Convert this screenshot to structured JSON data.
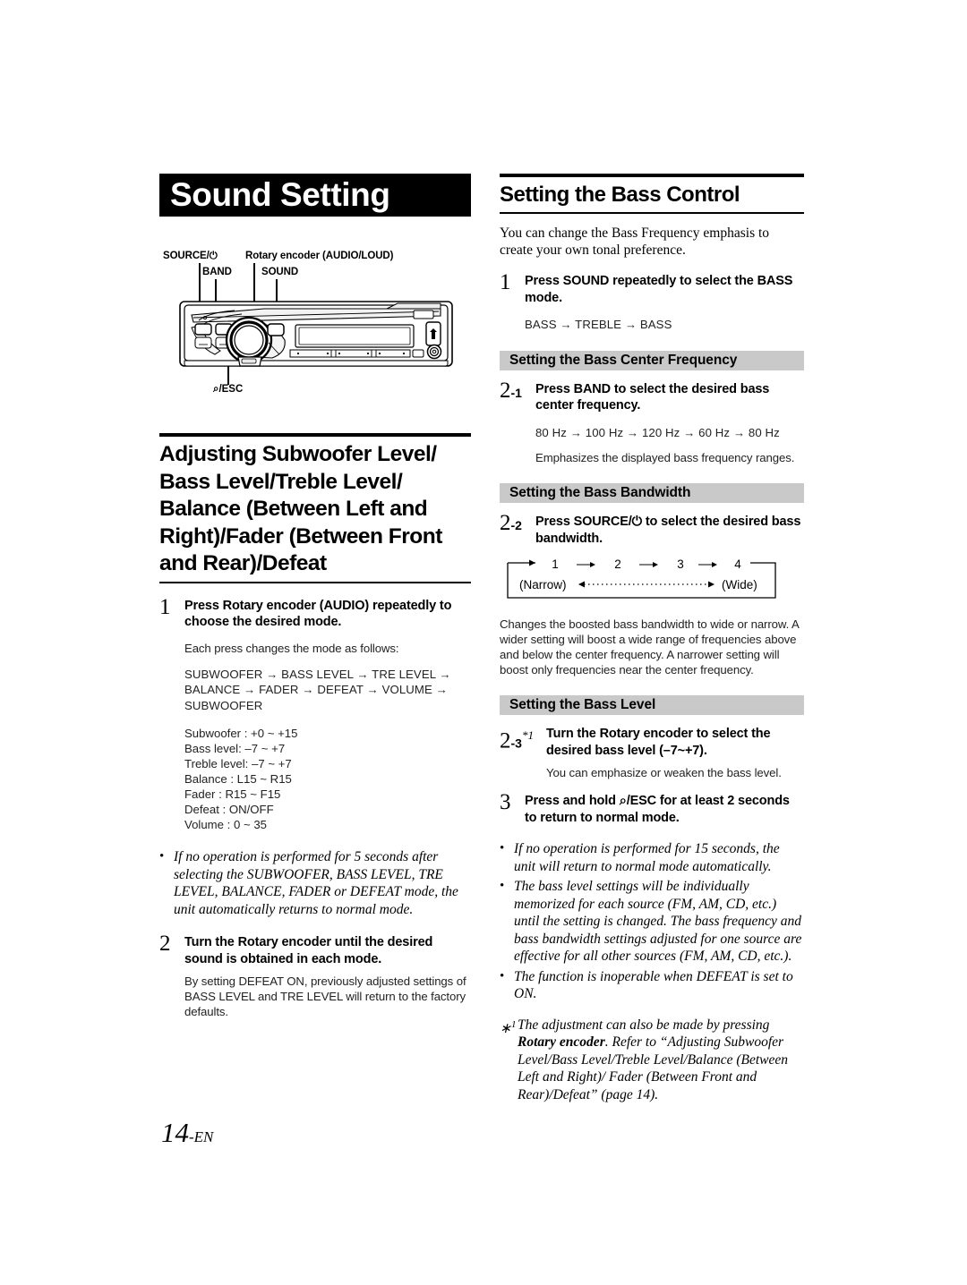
{
  "chapter": {
    "title": "Sound Setting"
  },
  "unit_diagram": {
    "labels": {
      "source": "SOURCE/⏻",
      "band": "BAND",
      "rotary": "Rotary encoder (AUDIO/LOUD)",
      "sound": "SOUND",
      "esc": "⌕/ESC"
    }
  },
  "left": {
    "heading": "Adjusting Subwoofer Level/ Bass Level/Treble Level/ Balance (Between Left and Right)/Fader (Between Front and Rear)/Defeat",
    "step1": {
      "num": "1",
      "title_pre": "Press ",
      "title_bold": "Rotary encoder (AUDIO)",
      "title_post": " repeatedly to choose the desired mode.",
      "intro": "Each press changes the mode as follows:",
      "flow": "SUBWOOFER → BASS LEVEL → TRE LEVEL → BALANCE → FADER → DEFEAT → VOLUME → SUBWOOFER",
      "ranges": [
        "Subwoofer : +0 ~ +15",
        "Bass level: –7 ~ +7",
        "Treble level: –7 ~ +7",
        "Balance : L15 ~ R15",
        "Fader : R15 ~ F15",
        "Defeat : ON/OFF",
        "Volume : 0 ~ 35"
      ],
      "note": "If no operation is performed for 5 seconds after selecting the SUBWOOFER, BASS LEVEL, TRE LEVEL, BALANCE, FADER or DEFEAT mode, the unit automatically returns to normal mode."
    },
    "step2": {
      "num": "2",
      "title_pre": "Turn the ",
      "title_bold": "Rotary encoder",
      "title_post": " until the desired sound is obtained in each mode.",
      "body": "By setting DEFEAT ON, previously adjusted settings of BASS LEVEL and TRE LEVEL will return to the factory defaults."
    }
  },
  "right": {
    "heading": "Setting the Bass Control",
    "intro": "You can change the Bass Frequency emphasis to create your own tonal preference.",
    "step1": {
      "num": "1",
      "title_pre": "Press ",
      "title_bold": "SOUND",
      "title_post": " repeatedly to select the BASS mode.",
      "flow": "BASS → TREBLE → BASS"
    },
    "center_freq": {
      "bar": "Setting the Bass Center Frequency",
      "num": "2",
      "num_sub": "-1",
      "title_pre": "Press ",
      "title_bold": "BAND",
      "title_post": " to select the desired bass center frequency.",
      "flow": "80 Hz → 100 Hz → 120 Hz → 60 Hz → 80 Hz",
      "body": "Emphasizes the displayed bass frequency ranges."
    },
    "bandwidth": {
      "bar": "Setting the Bass Bandwidth",
      "num": "2",
      "num_sub": "-2",
      "title_pre": "Press ",
      "title_bold": "SOURCE/⏻",
      "title_post": " to select the desired bass bandwidth.",
      "diagram": {
        "steps": [
          "1",
          "2",
          "3",
          "4"
        ],
        "left_label": "(Narrow)",
        "right_label": "(Wide)"
      },
      "body": "Changes the boosted bass bandwidth to wide or narrow. A wider setting will boost a wide range of frequencies above and below the center frequency. A narrower setting will boost only frequencies near the center frequency."
    },
    "bass_level": {
      "bar": "Setting the Bass Level",
      "num": "2",
      "num_sub": "-3",
      "footnote_mark": "*1",
      "title_pre": "Turn the ",
      "title_bold": "Rotary encoder",
      "title_post": " to select the desired bass level (–7~+7).",
      "body": "You can emphasize or weaken the bass level."
    },
    "step3": {
      "num": "3",
      "title_pre": "Press and hold ",
      "title_bold": "⌕/ESC",
      "title_post": " for at least 2 seconds to return to normal mode."
    },
    "notes": [
      "If no operation is performed for 15 seconds, the unit will return to normal mode automatically.",
      "The bass level settings will be individually memorized for each source (FM, AM, CD, etc.) until the setting is changed. The bass frequency and bass bandwidth settings adjusted for one source are effective for all other sources (FM, AM, CD, etc.).",
      "The function is inoperable when DEFEAT is set to ON."
    ],
    "footnote": {
      "mark": "*1",
      "pre": "The adjustment can also be made by pressing ",
      "bold": "Rotary encoder",
      "post": ". Refer to “Adjusting Subwoofer Level/Bass Level/Treble Level/Balance (Between Left and Right)/ Fader (Between Front and Rear)/Defeat” (page 14)."
    }
  },
  "footer": {
    "page_num": "14",
    "page_suffix": "-EN"
  },
  "colors": {
    "gray_bar": "#c9c9c9",
    "title_bg": "#000000"
  }
}
